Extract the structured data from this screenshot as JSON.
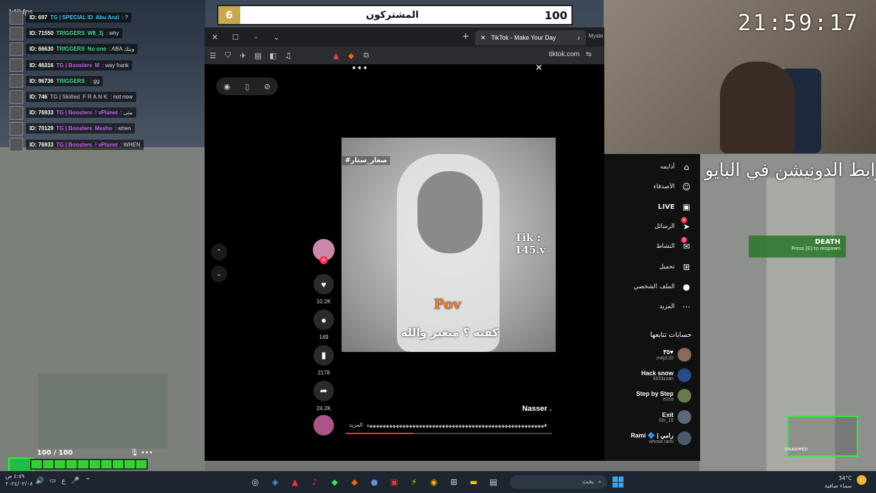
{
  "fps": "142 fps",
  "killfeed": [
    {
      "id": "ID: 697",
      "tag": "TG | SPECIAL ID",
      "tag_color": "#37c6f5",
      "name": "Abu Anzi",
      "name_color": "#37c6f5",
      "msg": ": ?"
    },
    {
      "id": "ID: 71550",
      "tag": "TRIGGERS",
      "tag_color": "#3fd98b",
      "name": "W8_3j",
      "name_color": "#3fd98b",
      "msg": ": why"
    },
    {
      "id": "ID: 66630",
      "tag": "TRIGGERS",
      "tag_color": "#3fd98b",
      "name": "No one",
      "name_color": "#3fd98b",
      "msg": ": ABA وينك"
    },
    {
      "id": "ID: 46316",
      "tag": "TG | Boosters",
      "tag_color": "#c561e8",
      "name": "M",
      "name_color": "#c561e8",
      "msg": ": way frank"
    },
    {
      "id": "ID: 96736",
      "tag": "TRIGGERS",
      "tag_color": "#3fd98b",
      "name": "",
      "name_color": "#3fd98b",
      "msg": ": gg"
    },
    {
      "id": "ID: 746",
      "tag": "TG | Skilled",
      "tag_color": "#a3a3a3",
      "name": "F R A N K",
      "name_color": "#a3a3a3",
      "msg": ": not now"
    },
    {
      "id": "ID: 76933",
      "tag": "TG | Boosters",
      "tag_color": "#c561e8",
      "name": "! vPlanet",
      "name_color": "#c561e8",
      "msg": ": متى"
    },
    {
      "id": "ID: 70129",
      "tag": "TG | Boosters",
      "tag_color": "#c561e8",
      "name": "Mesho",
      "name_color": "#c561e8",
      "msg": ": when"
    },
    {
      "id": "ID: 76933",
      "tag": "TG | Boosters",
      "tag_color": "#c561e8",
      "name": "! vPlanet",
      "name_color": "#c561e8",
      "msg": ": WHEN"
    }
  ],
  "subscribers": {
    "left_value": "6",
    "title": "المشتركون",
    "right_value": "100"
  },
  "clock": "21:59:17",
  "donation_text": "رابط الدونيشن في البايو",
  "death": {
    "title": "DEATH",
    "subtitle": "Press [E] to respawn"
  },
  "browser": {
    "tab_title": "TikTok - Make Your Day",
    "next_tab": "Myste",
    "url": "tiktok.com"
  },
  "video": {
    "tag": "#صغار_ستار",
    "watermark": "Tik :\n145.v",
    "pov": "Pov",
    "caption": "كفته ؟ متغير والله",
    "author": "Nasser .",
    "description": "ههههههههههههههههههههههههههههههههههههههههههههههههههههههه",
    "more_label": "المزيد",
    "progress": 0.33
  },
  "rail": {
    "likes": "10.2K",
    "comments": "149",
    "saves": "2178",
    "shares": "24.2K"
  },
  "sidebar": [
    {
      "label": "أذايمه",
      "icon": "home-icon",
      "glyph": "⌂",
      "badge": ""
    },
    {
      "label": "الأصدقاء",
      "icon": "friends-icon",
      "glyph": "☺",
      "badge": ""
    },
    {
      "label": "LIVE",
      "icon": "live-icon",
      "glyph": "▣",
      "badge": ""
    },
    {
      "label": "الرسائل",
      "icon": "messages-icon",
      "glyph": "➤",
      "badge": "6"
    },
    {
      "label": "النشاط",
      "icon": "activity-icon",
      "glyph": "✉",
      "badge": "9"
    },
    {
      "label": "تحميل",
      "icon": "upload-icon",
      "glyph": "⊞",
      "badge": ""
    },
    {
      "label": "الملف الشخصي",
      "icon": "profile-icon",
      "glyph": "●",
      "badge": ""
    },
    {
      "label": "المزيد",
      "icon": "more-icon",
      "glyph": "⋯",
      "badge": ""
    }
  ],
  "following_title": "حسابات تتابعها",
  "accounts": [
    {
      "name": "٣٥♥",
      "user": "m4jd.20"
    },
    {
      "name": "Hack snow",
      "user": "3333zzan"
    },
    {
      "name": "Step by Step",
      "user": "e2ca"
    },
    {
      "name": "Exit",
      "user": "Slo_15"
    },
    {
      "name": "Rami 🔷 | رامي",
      "user": "whose.rami"
    }
  ],
  "hud": {
    "health": "100 / 100",
    "segments": 10,
    "weapon": "UNARMED"
  },
  "taskbar": {
    "time": "٤:٥٩ ص",
    "date": "٢٠٢٤/٠٢/٠٨",
    "lang": "ع",
    "search_placeholder": "بحث",
    "temp": "34°C",
    "weather": "سماء صافية"
  }
}
